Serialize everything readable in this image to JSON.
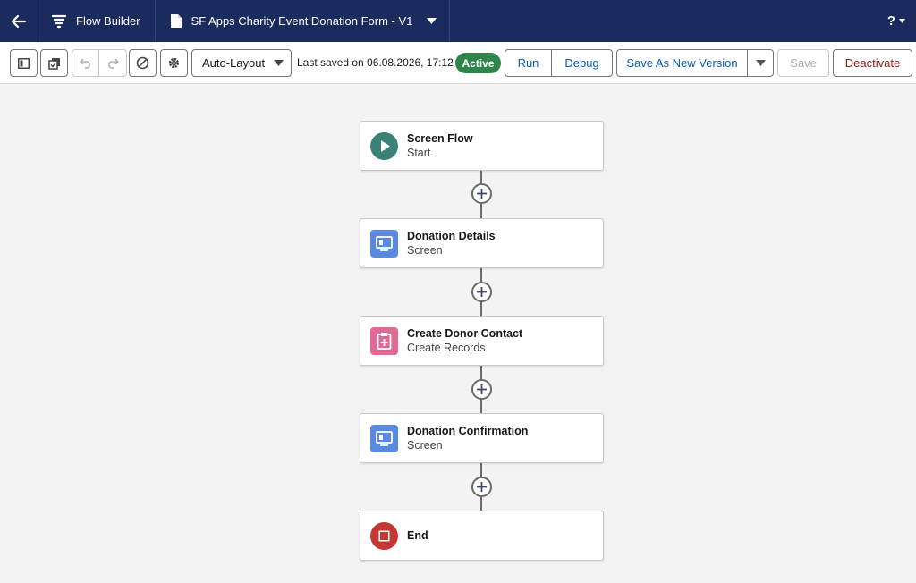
{
  "header": {
    "app_title": "Flow Builder",
    "flow_name": "SF Apps Charity Event Donation Form - V1",
    "help_label": "?"
  },
  "toolbar": {
    "layout_select": "Auto-Layout",
    "last_saved": "Last saved on 06.08.2026, 17:12",
    "status_badge": "Active",
    "run_label": "Run",
    "debug_label": "Debug",
    "save_as_new_version_label": "Save As New Version",
    "save_label": "Save",
    "deactivate_label": "Deactivate"
  },
  "flow": {
    "nodes": [
      {
        "title": "Screen Flow",
        "subtitle": "Start",
        "icon": "play-icon",
        "icon_color": "#3a8177"
      },
      {
        "title": "Donation Details",
        "subtitle": "Screen",
        "icon": "screen-icon",
        "icon_color": "#5a8ae0"
      },
      {
        "title": "Create Donor Contact",
        "subtitle": "Create Records",
        "icon": "create-record-icon",
        "icon_color": "#e06a94"
      },
      {
        "title": "Donation Confirmation",
        "subtitle": "Screen",
        "icon": "screen-icon",
        "icon_color": "#5a8ae0"
      },
      {
        "title": "End",
        "subtitle": "",
        "icon": "stop-icon",
        "icon_color": "#c23934"
      }
    ]
  },
  "colors": {
    "header_bg": "#1b2b5e",
    "active_badge": "#2e844a",
    "link_blue": "#0b5cab",
    "deactivate_red": "#8c1d18",
    "canvas_bg": "#f3f3f3"
  }
}
